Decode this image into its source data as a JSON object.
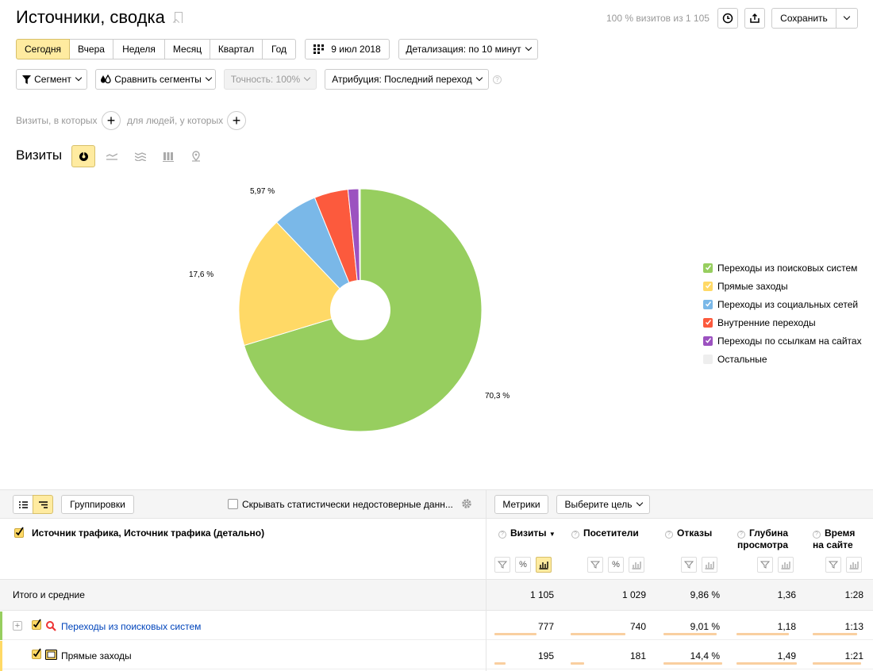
{
  "header": {
    "title": "Источники, сводка",
    "visits_info": "100 % визитов из 1 105",
    "save_label": "Сохранить"
  },
  "periods": [
    "Сегодня",
    "Вчера",
    "Неделя",
    "Месяц",
    "Квартал",
    "Год"
  ],
  "date_label": "9 июл 2018",
  "detail_label": "Детализация: по 10 минут",
  "filters": {
    "segment": "Сегмент",
    "compare": "Сравнить сегменты",
    "accuracy": "Точность: 100%",
    "attribution": "Атрибуция: Последний переход"
  },
  "conditions": {
    "visits_which": "Визиты, в которых",
    "people_which": "для людей, у которых"
  },
  "chart_title": "Визиты",
  "chart_data": {
    "type": "pie",
    "categories": [
      "Переходы из поисковых систем",
      "Прямые заходы",
      "Переходы из социальных сетей",
      "Внутренние переходы",
      "Переходы по ссылкам на сайтах",
      "Остальные"
    ],
    "values": [
      70.3,
      17.6,
      5.97,
      4.5,
      1.43,
      0.2
    ],
    "labels": [
      "70,3 %",
      "17,6 %",
      "5,97 %"
    ],
    "colors": [
      "#97ce5f",
      "#ffd966",
      "#7ab8e8",
      "#fc5a3d",
      "#9c52c0",
      "#eeeeee"
    ],
    "legend_position": "right"
  },
  "table_toolbar": {
    "groupings": "Группировки",
    "hide_unreliable": "Скрывать статистически недостоверные данн...",
    "metrics": "Метрики",
    "goal": "Выберите цель"
  },
  "table": {
    "dimension_header": "Источник трафика, Источник трафика (детально)",
    "columns": [
      "Визиты",
      "Посетители",
      "Отказы",
      "Глубина просмотра",
      "Время на сайте"
    ],
    "col_visits": "Визиты",
    "col_visitors": "Посетители",
    "col_bounce": "Отказы",
    "col_depth_1": "Глубина",
    "col_depth_2": "просмотра",
    "col_time_1": "Время",
    "col_time_2": "на сайте",
    "total": {
      "label": "Итого и средние",
      "values": [
        "1 105",
        "1 029",
        "9,86 %",
        "1,36",
        "1:28"
      ]
    },
    "rows": [
      {
        "label": "Переходы из поисковых систем",
        "values": [
          "777",
          "740",
          "9,01 %",
          "1,18",
          "1:13"
        ],
        "bars": [
          0.7,
          0.72,
          0.91,
          0.87,
          0.85
        ]
      },
      {
        "label": "Прямые заходы",
        "values": [
          "195",
          "181",
          "14,4 %",
          "1,49",
          "1:21"
        ],
        "bars": [
          0.18,
          0.18,
          1.0,
          1.0,
          0.93
        ]
      }
    ]
  }
}
